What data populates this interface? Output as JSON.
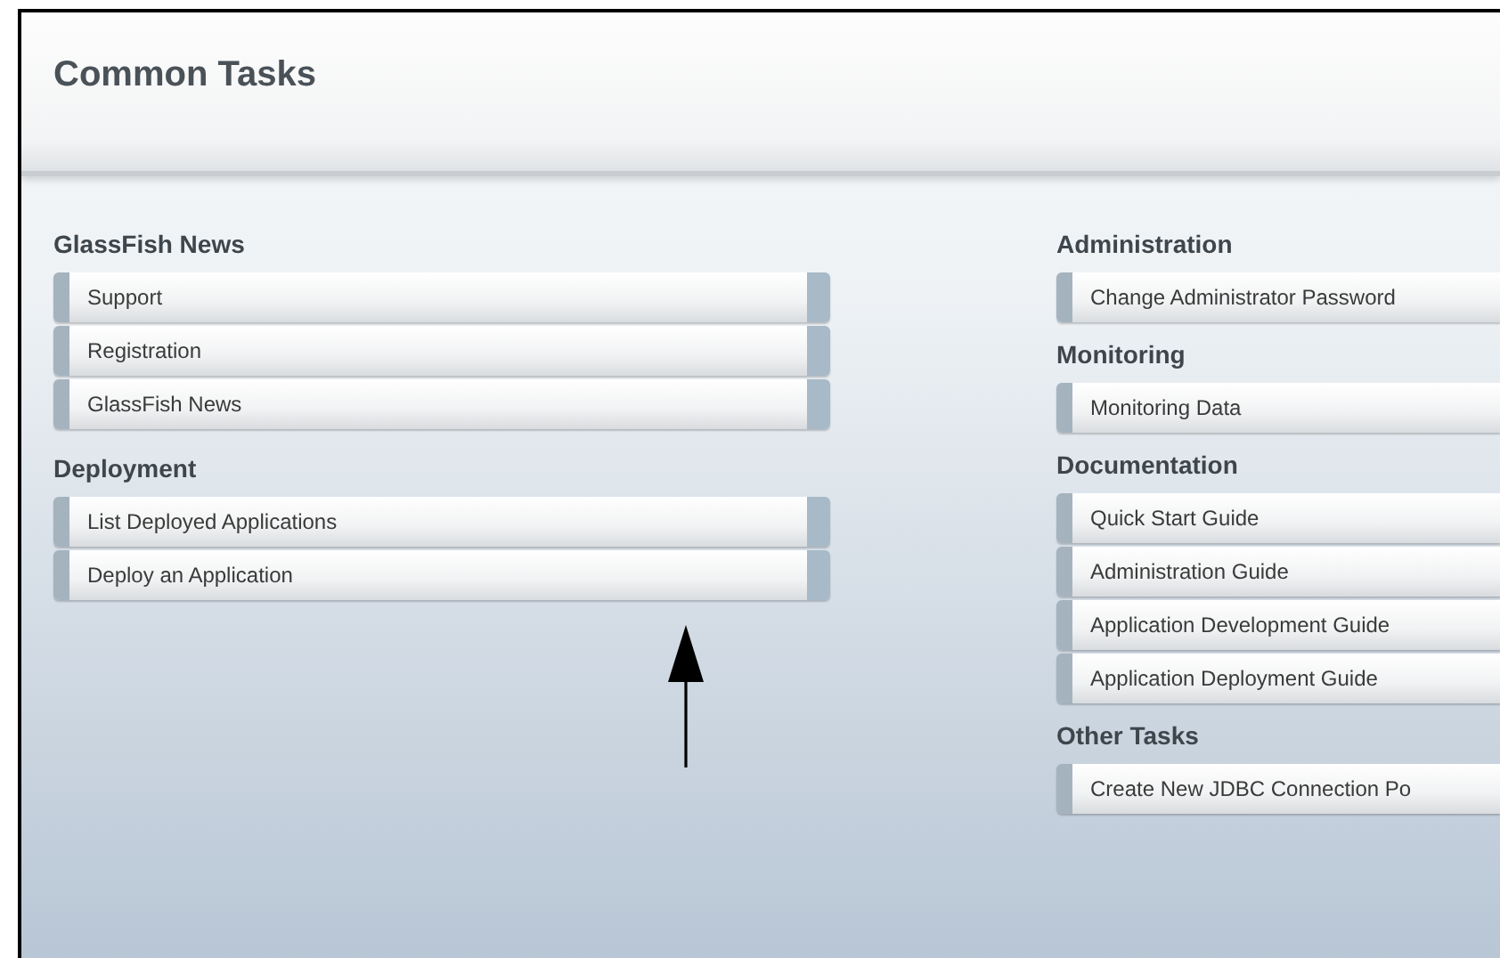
{
  "page_title": "Common Tasks",
  "left_column": [
    {
      "heading": "GlassFish News",
      "buttons": [
        "Support",
        "Registration",
        "GlassFish News"
      ]
    },
    {
      "heading": "Deployment",
      "buttons": [
        "List Deployed Applications",
        "Deploy an Application"
      ]
    }
  ],
  "right_column": [
    {
      "heading": "Administration",
      "buttons": [
        "Change Administrator Password"
      ]
    },
    {
      "heading": "Monitoring",
      "buttons": [
        "Monitoring Data"
      ]
    },
    {
      "heading": "Documentation",
      "buttons": [
        "Quick Start Guide",
        "Administration Guide",
        "Application Development Guide",
        "Application Deployment Guide"
      ]
    },
    {
      "heading": "Other Tasks",
      "buttons": [
        "Create New JDBC Connection Po"
      ]
    }
  ]
}
